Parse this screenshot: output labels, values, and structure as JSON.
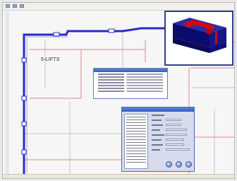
{
  "floor": {
    "zone_label": "5-LIFTS"
  },
  "colors": {
    "wall": "#2a2ac8",
    "grid_line": "#d98a8a",
    "room_line": "#c8c8c8",
    "model_body": "#0b0b6e",
    "model_cut": "#d10a0a"
  },
  "icons": {
    "app": "app-icon",
    "dialog_buttons": [
      "ok-icon",
      "apply-icon",
      "cancel-icon"
    ]
  }
}
